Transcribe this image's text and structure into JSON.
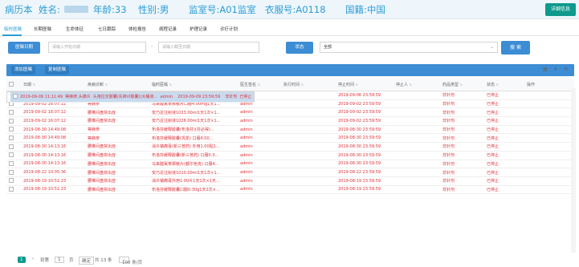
{
  "header": {
    "record_label": "病历本",
    "name_label": "姓名:",
    "age": "年龄:33",
    "gender": "性别:男",
    "ward": "监室号:A01监室",
    "uniform_no": "衣服号:A0118",
    "nationality": "国籍:中国",
    "detail_button": "详细信息"
  },
  "tabs": [
    "临时医嘱",
    "长期医嘱",
    "生命体征",
    "七日跟踪",
    "体检报告",
    "病程记录",
    "护理记录",
    "诊疗计划"
  ],
  "filter": {
    "date_button": "医嘱日期",
    "start_placeholder": "请输入开始日期",
    "separator": "-",
    "end_placeholder": "请输入截至日期",
    "status_button": "状态",
    "status_value": "全部",
    "search_button": "搜 索"
  },
  "toolbar": {
    "add": "添加医嘱",
    "copy": "复制医嘱"
  },
  "columns": [
    "日期",
    "疾病诊断",
    "临时医嘱",
    "医生签名",
    "执行时间",
    "停止时间",
    "停止人",
    "药品类型",
    "状态",
    "操作"
  ],
  "rows": [
    [
      "2019-09-09 11:11:49",
      "等麻疹,头痛炎",
      "头孢拉定胶囊(先锋VI胶囊)(大桶液…",
      "admin",
      "",
      "2019-09-09 23:59:59",
      "",
      "非针剂",
      "已停止",
      ""
    ],
    [
      "2019-09-06 15:54:08",
      "等麻疹",
      "马来酸氯苯那敏片口服4.00mg1天1…",
      "admin",
      "",
      "2019-09-06 23:59:59",
      "",
      "非针剂",
      "已停止",
      ""
    ],
    [
      "2019-09-02 16:07:12",
      "等麻疹",
      "马来酸氯苯那敏片口服4.00mg1天1…",
      "admin",
      "",
      "2019-09-02 23:59:59",
      "",
      "非针剂",
      "已停止",
      ""
    ],
    [
      "2019-09-02 16:07:12",
      "腰椎间盘突出症",
      "安乃近注射液1023.00ml1天1次×1…",
      "admin",
      "",
      "2019-09-02 23:59:59",
      "",
      "非针剂",
      "已停止",
      ""
    ],
    [
      "2019-09-02 16:07:12",
      "腰椎间盘突出症",
      "安乃近注射液1026.00ml1天1次×1…",
      "admin",
      "",
      "2019-09-02 23:59:59",
      "",
      "非针剂",
      "已停止",
      ""
    ],
    [
      "2019-08-30 14:49:08",
      "等麻疹",
      "布洛芬缓释胶囊(布洛芬)(芬必得)…",
      "admin",
      "",
      "2019-08-30 23:59:59",
      "",
      "非针剂",
      "已停止",
      ""
    ],
    [
      "2019-08-30 14:49:08",
      "等麻疹",
      "布洛芬缓释胶囊(巩凯) 口服4.00…",
      "admin",
      "",
      "2019-08-30 23:59:59",
      "",
      "非针剂",
      "已停止",
      ""
    ],
    [
      "2019-08-30 14:13:16",
      "腰椎间盘突出症",
      "消炎镇痛膏(新三普药) 外用1.00贴1…",
      "admin",
      "",
      "2019-08-30 23:59:59",
      "",
      "非针剂",
      "已停止",
      ""
    ],
    [
      "2019-08-30 14:13:16",
      "腰椎间盘突出症",
      "布洛芬缓释胶囊(新三普药) 口服0.3…",
      "admin",
      "",
      "2019-08-30 23:59:59",
      "",
      "非针剂",
      "已停止",
      ""
    ],
    [
      "2019-08-30 14:13:16",
      "腰椎间盘突出症",
      "马来酸氯苯那敏片(都尔色克) 口服4…",
      "admin",
      "",
      "2019-08-30 23:59:59",
      "",
      "非针剂",
      "已停止",
      ""
    ],
    [
      "2019-08-22 10:05:36",
      "腰椎间盘突出症",
      "安乃近注射液1010.00ml1天1次×1…",
      "admin",
      "",
      "2019-08-22 23:59:59",
      "",
      "非针剂",
      "已停止",
      ""
    ],
    [
      "2019-08-19 10:51:23",
      "腰椎间盘突出症",
      "消炎镇痛膏外用1.00片1天1次×1天…",
      "admin",
      "",
      "2019-08-19 23:59:59",
      "",
      "非针剂",
      "已停止",
      ""
    ],
    [
      "2019-08-19 10:51:23",
      "腰椎间盘突出症",
      "布洛芬缓释胶囊口服0.30g1天2次×…",
      "admin",
      "",
      "2019-08-19 23:59:59",
      "",
      "非针剂",
      "已停止",
      ""
    ]
  ],
  "pager": {
    "current": "1",
    "prev": "‹",
    "goto_label": "到第",
    "goto_value": "1",
    "page_unit": "页",
    "confirm": "确定",
    "total": "共 13 条",
    "per_page": "100 条/页"
  },
  "icons": {
    "print": "print-icon",
    "export": "export-icon",
    "settings": "gear-icon"
  },
  "colors": {
    "accent": "#3c8dd4",
    "detail_button": "#0d9a8d",
    "header_text": "#2a9cd6",
    "row_text": "#e0323a",
    "selected_row": "#c7dbf0"
  }
}
